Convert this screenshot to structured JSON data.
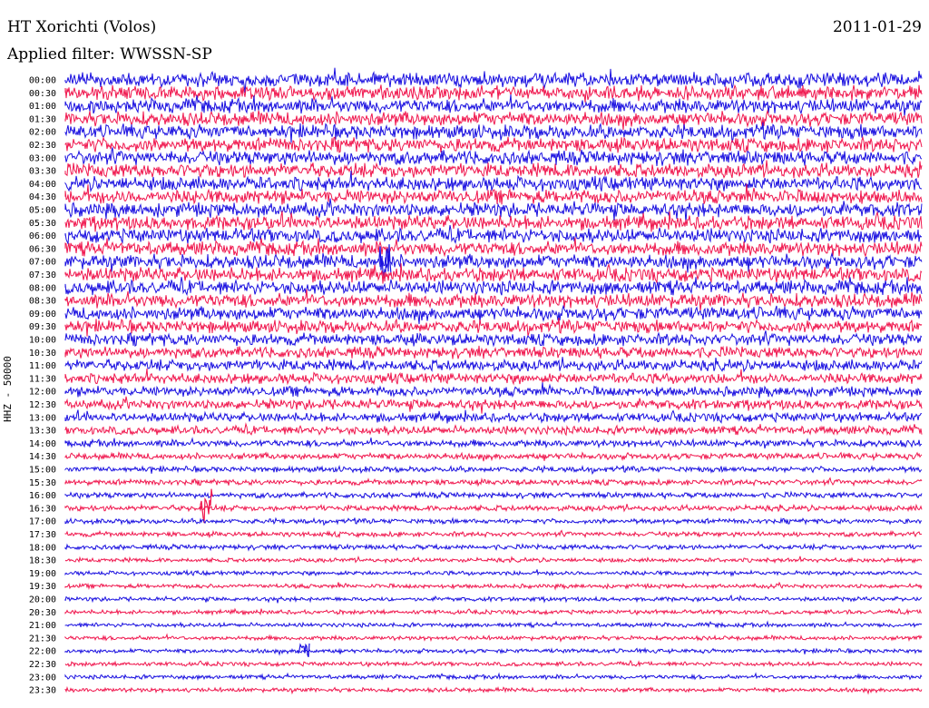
{
  "header": {
    "station": "HT Xorichti (Volos)",
    "date": "2011-01-29",
    "filter": "Applied filter: WWSSN-SP",
    "side_label": "HHZ - 50000"
  },
  "colors": {
    "trace_a": "#1a10e0",
    "trace_b": "#f0174e",
    "background": "#ffffff"
  },
  "chart_data": {
    "type": "line",
    "title": "HT Xorichti (Volos)",
    "subtitle": "Applied filter: WWSSN-SP",
    "ylabel": "HHZ - 50000",
    "alternating_colors": [
      "#1a10e0",
      "#f0174e"
    ],
    "rows": [
      "00:00",
      "00:30",
      "01:00",
      "01:30",
      "02:00",
      "02:30",
      "03:00",
      "03:30",
      "04:00",
      "04:30",
      "05:00",
      "05:30",
      "06:00",
      "06:30",
      "07:00",
      "07:30",
      "08:00",
      "08:30",
      "09:00",
      "09:30",
      "10:00",
      "10:30",
      "11:00",
      "11:30",
      "12:00",
      "12:30",
      "13:00",
      "13:30",
      "14:00",
      "14:30",
      "15:00",
      "15:30",
      "16:00",
      "16:30",
      "17:00",
      "17:30",
      "18:00",
      "18:30",
      "19:00",
      "19:30",
      "20:00",
      "20:30",
      "21:00",
      "21:30",
      "22:00",
      "22:30",
      "23:00",
      "23:30"
    ],
    "amplitude_relative": [
      1.0,
      1.0,
      1.0,
      1.0,
      1.0,
      1.0,
      1.0,
      1.0,
      1.0,
      1.0,
      1.0,
      1.0,
      1.0,
      1.0,
      1.0,
      1.0,
      1.0,
      1.0,
      0.95,
      0.9,
      0.85,
      0.8,
      0.8,
      0.75,
      0.7,
      0.7,
      0.65,
      0.6,
      0.5,
      0.45,
      0.4,
      0.4,
      0.4,
      0.4,
      0.35,
      0.35,
      0.35,
      0.3,
      0.3,
      0.3,
      0.3,
      0.3,
      0.3,
      0.3,
      0.3,
      0.3,
      0.3,
      0.3
    ],
    "events": [
      {
        "row": "07:00",
        "amplitude_relative": 2.2
      },
      {
        "row": "16:30",
        "amplitude_relative": 2.5
      },
      {
        "row": "22:00",
        "amplitude_relative": 1.2
      }
    ],
    "grid": false,
    "legend": "none"
  }
}
